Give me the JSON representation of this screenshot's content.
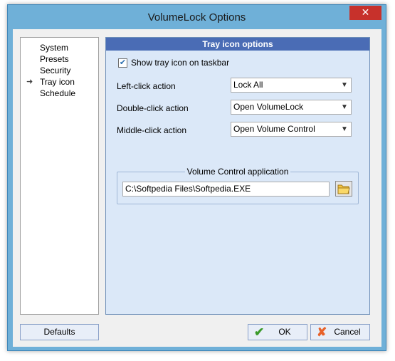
{
  "window": {
    "title": "VolumeLock Options",
    "close_label": "✕"
  },
  "nav": {
    "items": [
      {
        "label": "System"
      },
      {
        "label": "Presets"
      },
      {
        "label": "Security"
      },
      {
        "label": "Tray icon",
        "selected": true
      },
      {
        "label": "Schedule"
      }
    ]
  },
  "panel": {
    "header": "Tray icon options",
    "show_tray_checkbox": {
      "label": "Show tray icon on taskbar",
      "checked": true
    },
    "left_click": {
      "label": "Left-click action",
      "value": "Lock All"
    },
    "double_click": {
      "label": "Double-click action",
      "value": "Open VolumeLock"
    },
    "middle_click": {
      "label": "Middle-click action",
      "value": "Open Volume Control"
    },
    "volume_group": {
      "legend": "Volume Control application",
      "path_value": "C:\\Softpedia Files\\Softpedia.EXE"
    }
  },
  "buttons": {
    "defaults": "Defaults",
    "ok": "OK",
    "cancel": "Cancel"
  },
  "colors": {
    "title_bar": "#6fb0d8",
    "panel_header": "#4a6cb5",
    "panel_bg": "#dbe8f8",
    "close": "#c7312b"
  }
}
